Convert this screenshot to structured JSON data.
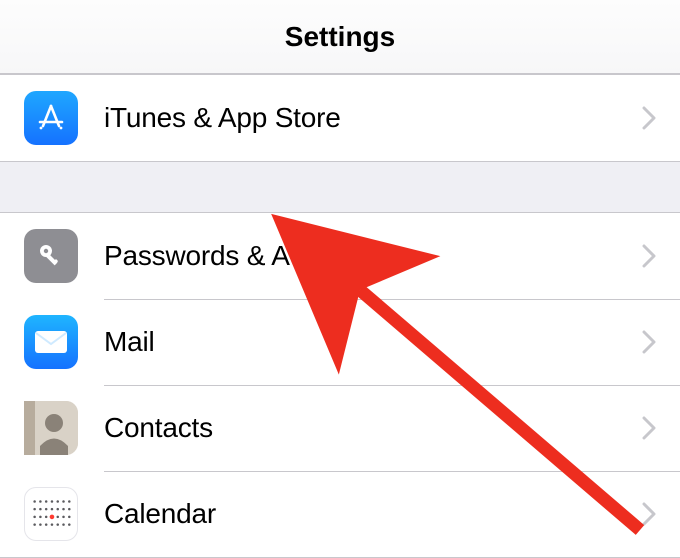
{
  "header": {
    "title": "Settings"
  },
  "groups": [
    {
      "items": [
        {
          "key": "itunes",
          "label": "iTunes & App Store",
          "icon": "appstore-icon"
        }
      ]
    },
    {
      "items": [
        {
          "key": "passwords",
          "label": "Passwords & Accounts",
          "icon": "key-icon"
        },
        {
          "key": "mail",
          "label": "Mail",
          "icon": "mail-icon"
        },
        {
          "key": "contacts",
          "label": "Contacts",
          "icon": "contacts-icon"
        },
        {
          "key": "calendar",
          "label": "Calendar",
          "icon": "calendar-icon"
        }
      ]
    }
  ],
  "colors": {
    "accent_blue": "#1a84ff",
    "divider": "#c8c7cc",
    "group_bg": "#efeff4",
    "annotation": "#ed2d1f"
  }
}
